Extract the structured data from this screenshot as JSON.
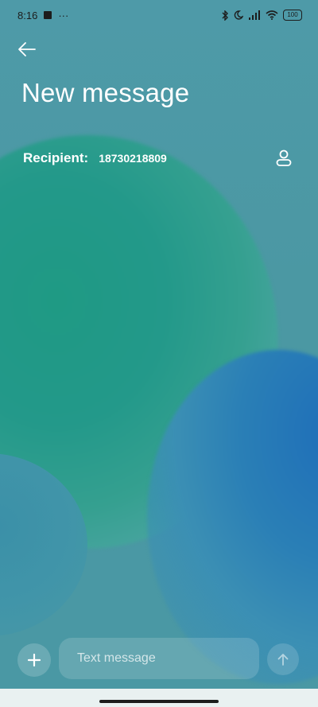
{
  "statusbar": {
    "time": "8:16",
    "more": "···",
    "battery": "100",
    "icons": [
      "app-square-icon",
      "bluetooth-icon",
      "moon-icon",
      "signal-icon",
      "wifi-icon",
      "battery-icon"
    ]
  },
  "header": {
    "title": "New message"
  },
  "recipient": {
    "label": "Recipient:",
    "value": "18730218809"
  },
  "composer": {
    "placeholder": "Text message"
  },
  "colors": {
    "background": "#4b9aa6",
    "green_blob": "#1f9a84",
    "blue_blob": "#1f6fb9",
    "text": "#ffffff",
    "navbar": "#e9f1f1"
  }
}
